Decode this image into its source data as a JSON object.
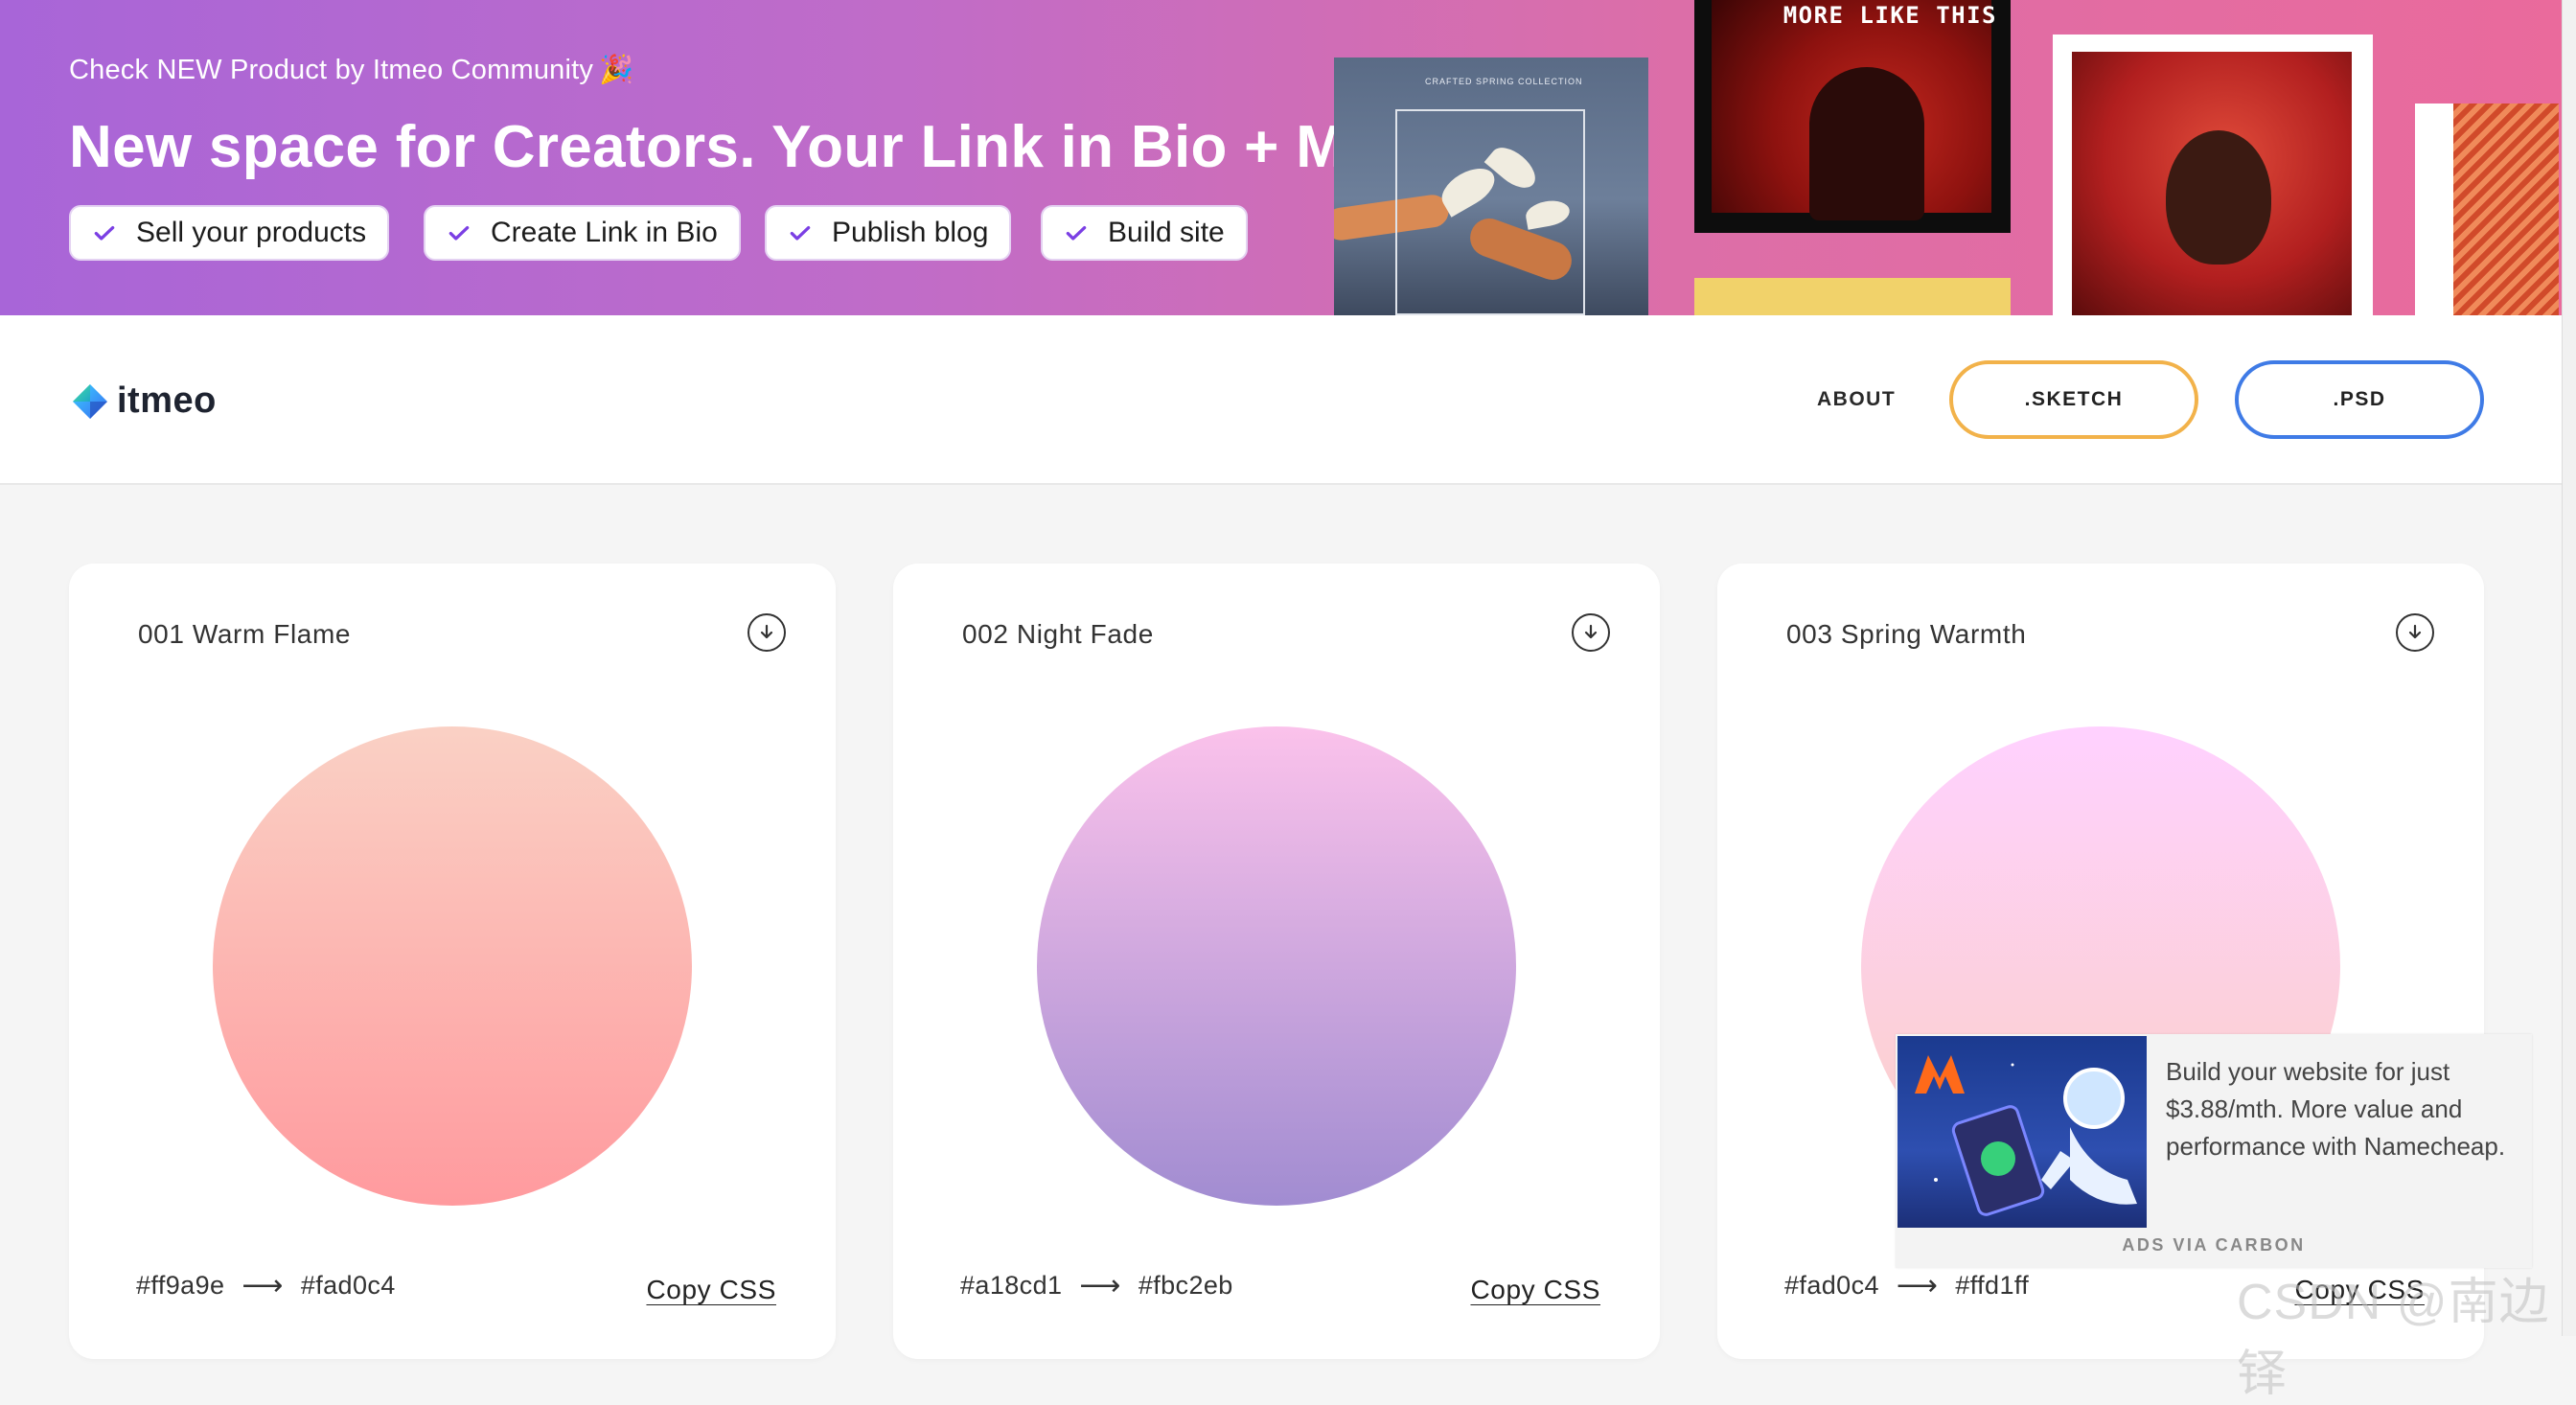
{
  "banner": {
    "kicker": "Check NEW Product by Itmeo Community",
    "kicker_emoji": "🎉",
    "title": "New space for Creators. Your Link in Bio + Market.",
    "chips": [
      "Sell your products",
      "Create Link in Bio",
      "Publish blog",
      "Build site"
    ],
    "poster_caption": "CRAFTED SPRING COLLECTION",
    "poster_tag": "MORE LIKE THIS"
  },
  "header": {
    "logo": "itmeo",
    "nav_about": "ABOUT",
    "sketch_button": ".SKETCH",
    "psd_button": ".PSD"
  },
  "cards": [
    {
      "title": "001 Warm Flame",
      "from": "#ff9a9e",
      "to": "#fad0c4",
      "copy": "Copy CSS"
    },
    {
      "title": "002 Night Fade",
      "from": "#a18cd1",
      "to": "#fbc2eb",
      "copy": "Copy CSS"
    },
    {
      "title": "003 Spring Warmth",
      "from": "#fad0c4",
      "to": "#ffd1ff",
      "copy": "Copy CSS"
    }
  ],
  "ad": {
    "text": "Build your website for just $3.88/mth. More value and performance with Namecheap.",
    "via": "ADS VIA CARBON"
  },
  "watermark": "CSDN @南边铎",
  "colors": {
    "banner_start": "#a865d8",
    "banner_end": "#ea6a9c",
    "check": "#7b3fe4",
    "sketch_border": "#f2b24a",
    "psd_border": "#3f7be6"
  },
  "icons": {
    "chip_check": "check-icon",
    "download": "download-icon",
    "logo": "itmeo-logo-icon"
  }
}
